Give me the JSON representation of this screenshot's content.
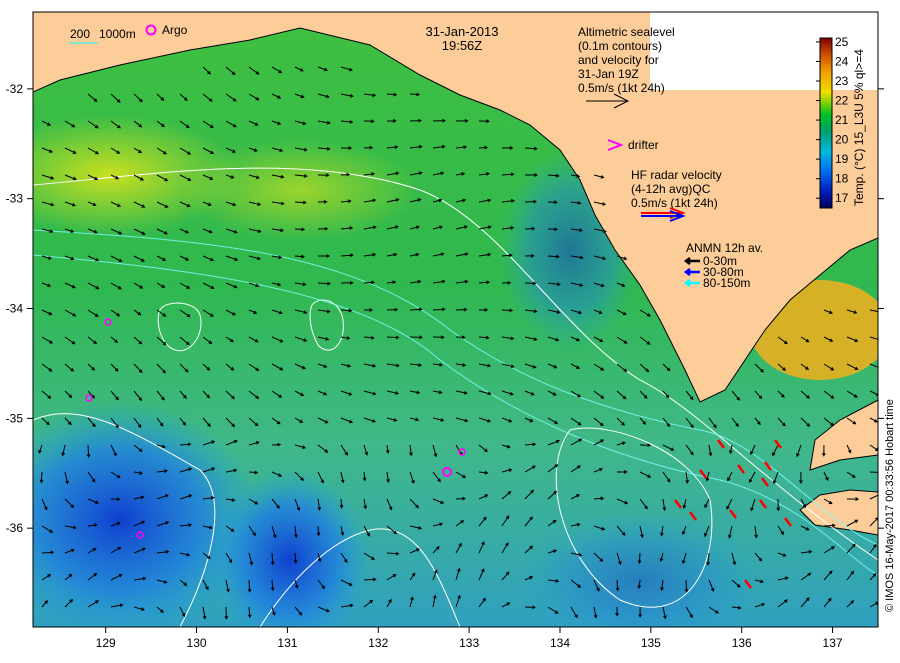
{
  "map": {
    "date": "31-Jan-2013",
    "time": "19:56Z",
    "scale_legend": {
      "label_a": "200",
      "label_b": "1000m"
    },
    "argo_label": "Argo",
    "altimetry_legend": [
      "Altimetric sealevel",
      "(0.1m contours)",
      "and velocity for",
      "31-Jan 19Z",
      "0.5m/s (1kt 24h)"
    ],
    "drifter_label": "drifter",
    "hf_radar_legend": [
      "HF radar velocity",
      "(4-12h avg)QC",
      "0.5m/s (1kt 24h)"
    ],
    "anmn_legend": {
      "title": "ANMN 12h av.",
      "items": [
        {
          "label": "0-30m",
          "color": "#000000"
        },
        {
          "label": "30-80m",
          "color": "#0000ff"
        },
        {
          "label": "80-150m",
          "color": "#00ffff"
        }
      ]
    },
    "colorbar": {
      "label": "Temp. (°C) 15_L3U 5% ql>=4",
      "ticks": [
        "25",
        "24",
        "23",
        "22",
        "21",
        "20",
        "19",
        "18",
        "17"
      ],
      "range": [
        16.5,
        25.2
      ]
    },
    "x_ticks": [
      "129",
      "130",
      "131",
      "132",
      "133",
      "134",
      "135",
      "136",
      "137"
    ],
    "y_ticks": [
      "-32",
      "-33",
      "-34",
      "-35",
      "-36"
    ],
    "lon_range": [
      128.2,
      137.5
    ],
    "lat_range": [
      -31.3,
      -36.9
    ],
    "credit": "© IMOS 16-May-2017 00:33:56 Hobart time",
    "colors": {
      "land": "#fccc99",
      "argo": "#ff00ff",
      "hf_radar_a": "#ff0000",
      "hf_radar_b": "#0000ff"
    }
  }
}
